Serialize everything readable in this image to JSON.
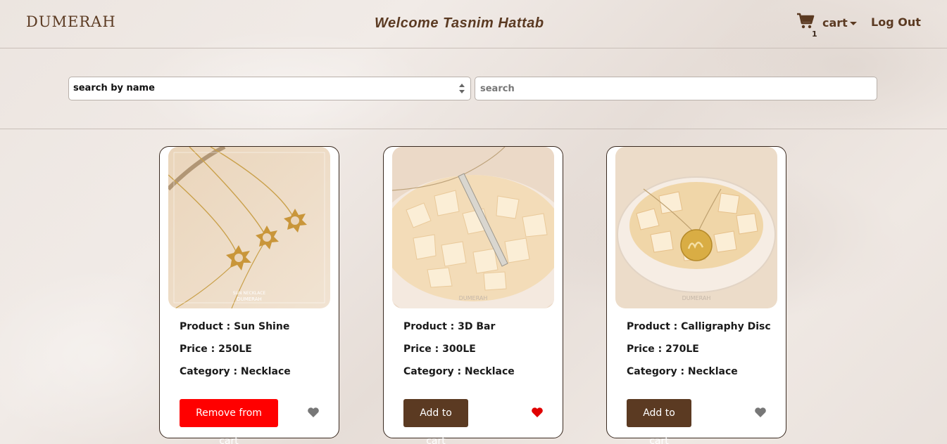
{
  "header": {
    "brand": "DUMERAH",
    "welcome": "Welcome Tasnim Hattab",
    "cart_label": "cart",
    "cart_count": "1",
    "logout": "Log Out"
  },
  "search": {
    "filter_selected": "search by name",
    "placeholder": "search"
  },
  "products": [
    {
      "product_label": "Product : Sun Shine",
      "price_label": "Price : 250LE",
      "category_label": "Category : Necklace",
      "button_label": "Remove from cart",
      "favorited": false,
      "image_caption": "SUN NECKLACE DUMERAH"
    },
    {
      "product_label": "Product : 3D Bar",
      "price_label": "Price : 300LE",
      "category_label": "Category : Necklace",
      "button_label": "Add to cart",
      "favorited": true,
      "image_caption": "DUMERAH"
    },
    {
      "product_label": "Product : Calligraphy Disc",
      "price_label": "Price : 270LE",
      "category_label": "Category : Necklace",
      "button_label": "Add to cart",
      "favorited": false,
      "image_caption": "DUMERAH"
    }
  ],
  "colors": {
    "brand_brown": "#5b3a22",
    "remove_red": "#ff0000",
    "heart_active": "#e00000",
    "heart_inactive": "#777777"
  },
  "icons": [
    "cart-icon",
    "caret-down-icon",
    "select-arrows-icon",
    "heart-icon"
  ]
}
